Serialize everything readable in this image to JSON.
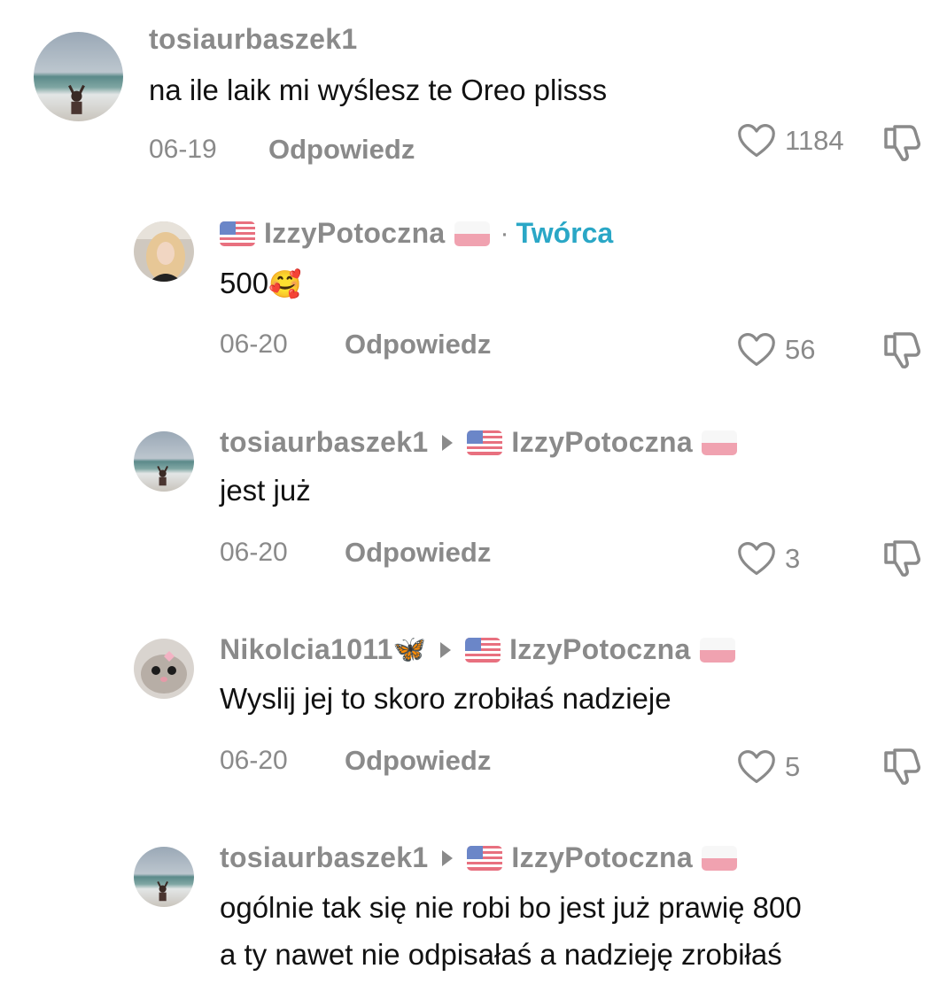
{
  "colors": {
    "meta_gray": "#8a8a8a",
    "text": "#111111",
    "creator_accent": "#2aa7c6"
  },
  "comments": [
    {
      "username": "tosiaurbaszek1",
      "text": "na ile laik mi wyślesz te Oreo plisss",
      "date": "06-19",
      "reply_label": "Odpowiedz",
      "likes": "1184"
    },
    {
      "username": "IzzyPotoczna",
      "creator_label": "Twórca",
      "text": "500",
      "emoji": "🥰",
      "date": "06-20",
      "reply_label": "Odpowiedz",
      "likes": "56"
    },
    {
      "username": "tosiaurbaszek1",
      "reply_to": "IzzyPotoczna",
      "text": "jest już",
      "date": "06-20",
      "reply_label": "Odpowiedz",
      "likes": "3"
    },
    {
      "username": "Nikolcia1011",
      "username_emoji": "🦋",
      "reply_to": "IzzyPotoczna",
      "text": "Wyslij jej to skoro zrobiłaś nadzieje",
      "date": "06-20",
      "reply_label": "Odpowiedz",
      "likes": "5"
    },
    {
      "username": "tosiaurbaszek1",
      "reply_to": "IzzyPotoczna",
      "text_line1": "ogólnie tak się nie robi bo jest już prawię 800",
      "text_line2": "a ty nawet nie odpisałaś a nadzieję zrobiłaś"
    }
  ]
}
